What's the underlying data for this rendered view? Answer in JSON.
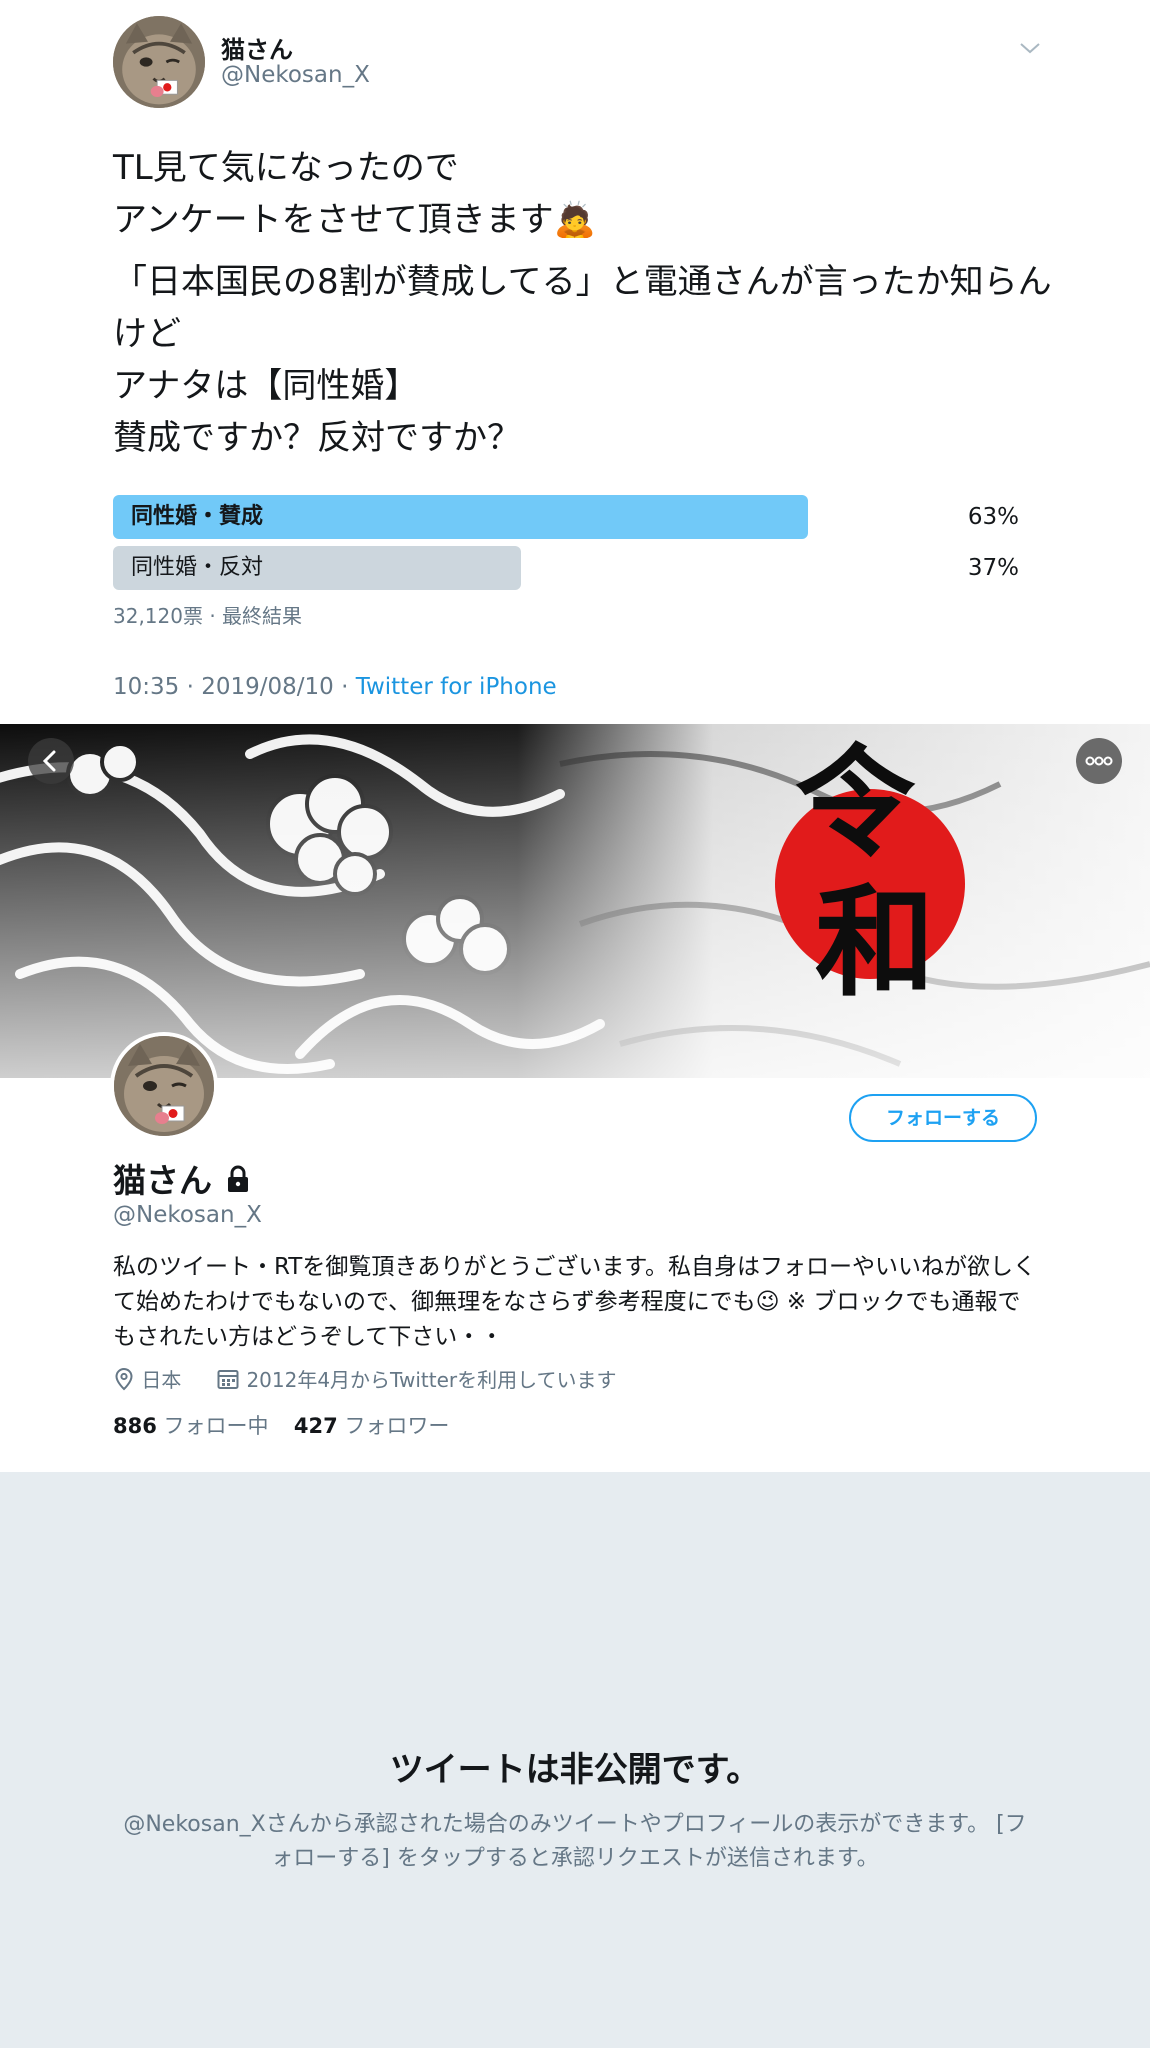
{
  "tweet": {
    "display_name": "猫さん",
    "handle": "@Nekosan_X",
    "text_1": "TL見て気になったので\nアンケートをさせて頂きます🙇",
    "text_2": "「日本国民の8割が賛成してる」と電通さんが言ったか知らんけど\nアナタは【同性婚】\n賛成ですか？反対ですか？",
    "poll": {
      "options": [
        {
          "label": "同性婚・賛成",
          "percent_text": "63%",
          "percent": 63
        },
        {
          "label": "同性婚・反対",
          "percent_text": "37%",
          "percent": 37
        }
      ],
      "summary": "32,120票 · 最終結果"
    },
    "timestamp": "10:35 · 2019/08/10 · ",
    "source": "Twitter for iPhone"
  },
  "banner": {
    "calligraphy_1": "令",
    "calligraphy_2": "和"
  },
  "profile": {
    "display_name": "猫さん",
    "handle": "@Nekosan_X",
    "follow_label": "フォローする",
    "bio": "私のツイート・RTを御覧頂きありがとうございます。私自身はフォローやいいねが欲しくて始めたわけでもないので、御無理をなさらず参考程度にでも😉 ※ ブロックでも通報でもされたい方はどうぞして下さい・・",
    "location": "日本",
    "joined": "2012年4月からTwitterを利用しています",
    "following_count": "886",
    "following_label": "フォロー中",
    "followers_count": "427",
    "followers_label": "フォロワー"
  },
  "protected": {
    "title": "ツイートは非公開です。",
    "description": "@Nekosan_Xさんから承認された場合のみツイートやプロフィールの表示ができます。 [フォローする] をタップすると承認リクエストが送信されます。"
  },
  "icons": {
    "caret": "chevron-down-icon",
    "back": "chevron-left-icon",
    "more": "more-dots-icon",
    "lock": "lock-icon",
    "location": "location-pin-icon",
    "calendar": "calendar-icon"
  },
  "colors": {
    "accent": "#1da1f2",
    "poll_leading": "#71c9f8",
    "poll_other": "#ccd6dd",
    "protected_bg": "#e6ecf0",
    "sun": "#e11b1b"
  }
}
